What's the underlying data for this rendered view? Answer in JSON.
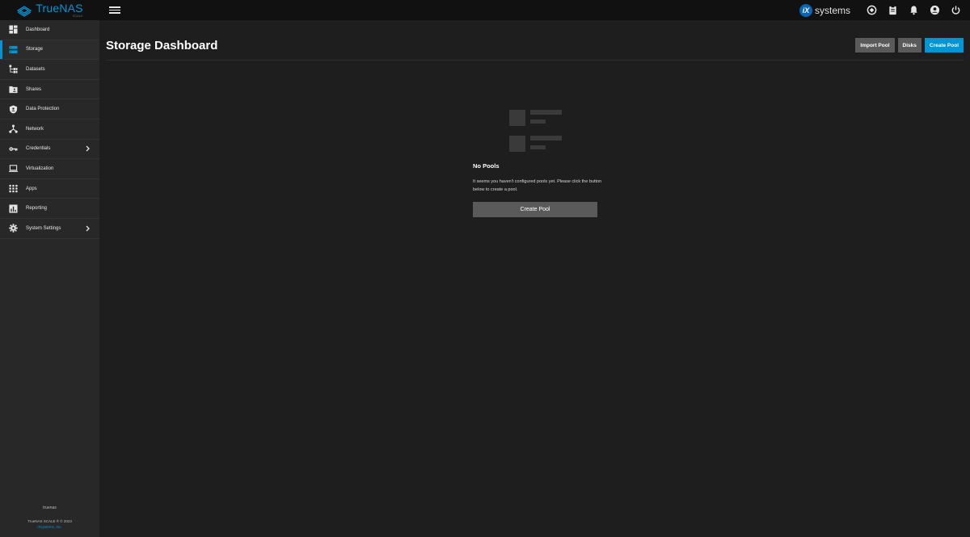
{
  "app": {
    "brand_name": "TrueNAS",
    "brand_sub": "SCALE",
    "accent_color": "#0095d5"
  },
  "topbar": {
    "vendor_mark": "iX",
    "vendor_text": "systems",
    "icons": [
      "truecommand-icon",
      "jobs-clipboard-icon",
      "notifications-bell-icon",
      "account-circle-icon",
      "power-icon"
    ]
  },
  "sidebar": {
    "items": [
      {
        "label": "Dashboard",
        "icon": "dashboard-icon"
      },
      {
        "label": "Storage",
        "icon": "storage-icon",
        "active": true
      },
      {
        "label": "Datasets",
        "icon": "datasets-icon"
      },
      {
        "label": "Shares",
        "icon": "shares-icon"
      },
      {
        "label": "Data Protection",
        "icon": "shield-icon"
      },
      {
        "label": "Network",
        "icon": "network-icon"
      },
      {
        "label": "Credentials",
        "icon": "key-icon",
        "expandable": true
      },
      {
        "label": "Virtualization",
        "icon": "laptop-icon"
      },
      {
        "label": "Apps",
        "icon": "apps-grid-icon"
      },
      {
        "label": "Reporting",
        "icon": "reporting-icon"
      },
      {
        "label": "System Settings",
        "icon": "gear-icon",
        "expandable": true
      }
    ],
    "footer": {
      "hostname": "truenas",
      "copyright": "TrueNAS SCALE ® © 2023",
      "company": "iXsystems, Inc."
    }
  },
  "main": {
    "title": "Storage Dashboard",
    "actions": {
      "import_pool": "Import Pool",
      "disks": "Disks",
      "create_pool": "Create Pool"
    },
    "empty_state": {
      "title": "No Pools",
      "message": "It seems you haven't configured pools yet. Please click the button below to create a pool.",
      "button": "Create Pool"
    }
  }
}
